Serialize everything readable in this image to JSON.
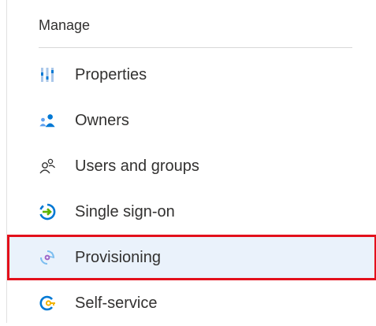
{
  "section": {
    "title": "Manage"
  },
  "menu": {
    "items": [
      {
        "label": "Properties",
        "icon": "properties-icon"
      },
      {
        "label": "Owners",
        "icon": "owners-icon"
      },
      {
        "label": "Users and groups",
        "icon": "users-groups-icon"
      },
      {
        "label": "Single sign-on",
        "icon": "single-sign-on-icon"
      },
      {
        "label": "Provisioning",
        "icon": "provisioning-icon",
        "selected": true
      },
      {
        "label": "Self-service",
        "icon": "self-service-icon"
      }
    ]
  },
  "colors": {
    "selection_border": "#e3101b",
    "selection_background": "#eaf2fb",
    "accent_blue": "#0078d4",
    "accent_green": "#5db300"
  }
}
